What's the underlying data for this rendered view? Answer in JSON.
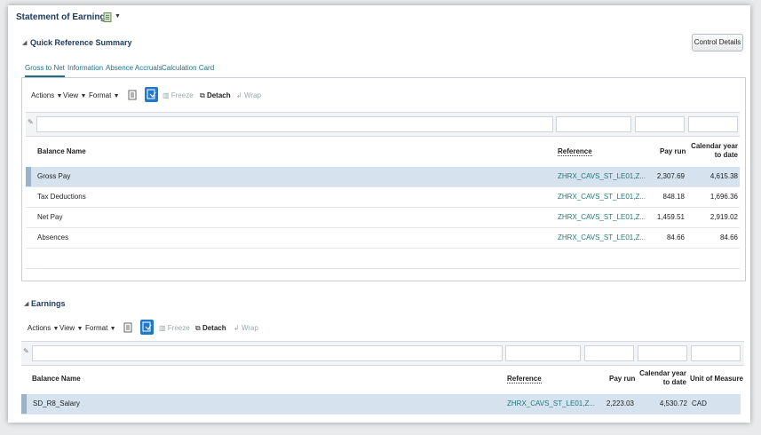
{
  "page": {
    "title": "Statement of Earnings"
  },
  "summary": {
    "heading": "Quick Reference Summary",
    "control_details": "Control Details",
    "tabs": [
      "Gross to Net",
      "Information",
      "Absence Accruals",
      "Calculation Card"
    ],
    "toolbar": {
      "actions": "Actions",
      "view": "View",
      "format": "Format",
      "freeze": "Freeze",
      "detach": "Detach",
      "wrap": "Wrap"
    },
    "columns": {
      "name": "Balance Name",
      "reference": "Reference",
      "pay_run": "Pay run",
      "cal_year_1": "Calendar year",
      "cal_year_2": "to date"
    },
    "rows": [
      {
        "name": "Gross Pay",
        "reference": "ZHRX_CAVS_ST_LE01,Z...",
        "pay_run": "2,307.69",
        "cal_year": "4,615.38"
      },
      {
        "name": "Tax Deductions",
        "reference": "ZHRX_CAVS_ST_LE01,Z...",
        "pay_run": "848.18",
        "cal_year": "1,696.36"
      },
      {
        "name": "Net Pay",
        "reference": "ZHRX_CAVS_ST_LE01,Z...",
        "pay_run": "1,459.51",
        "cal_year": "2,919.02"
      },
      {
        "name": "Absences",
        "reference": "ZHRX_CAVS_ST_LE01,Z...",
        "pay_run": "84.66",
        "cal_year": "84.66"
      }
    ]
  },
  "earnings": {
    "heading": "Earnings",
    "toolbar": {
      "actions": "Actions",
      "view": "View",
      "format": "Format",
      "freeze": "Freeze",
      "detach": "Detach",
      "wrap": "Wrap"
    },
    "columns": {
      "name": "Balance Name",
      "reference": "Reference",
      "pay_run": "Pay run",
      "cal_year_1": "Calendar year",
      "cal_year_2": "to date",
      "uom": "Unit of Measure"
    },
    "rows": [
      {
        "name": "SD_R8_Salary",
        "reference": "ZHRX_CAVS_ST_LE01,Z...",
        "pay_run": "2,223.03",
        "cal_year": "4,530.72",
        "uom": "CAD"
      }
    ]
  }
}
